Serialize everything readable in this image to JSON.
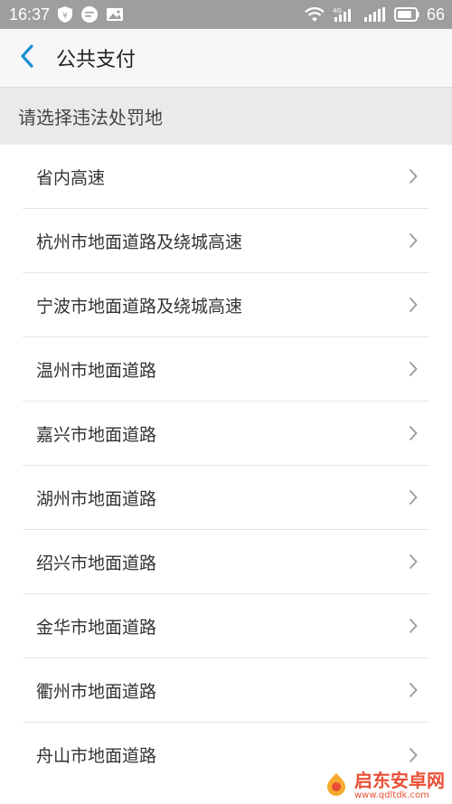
{
  "status_bar": {
    "time": "16:37",
    "battery_level": "66",
    "network_label": "4G"
  },
  "header": {
    "title": "公共支付"
  },
  "section": {
    "title": "请选择违法处罚地"
  },
  "regions": [
    {
      "label": "省内高速"
    },
    {
      "label": "杭州市地面道路及绕城高速"
    },
    {
      "label": "宁波市地面道路及绕城高速"
    },
    {
      "label": "温州市地面道路"
    },
    {
      "label": "嘉兴市地面道路"
    },
    {
      "label": "湖州市地面道路"
    },
    {
      "label": "绍兴市地面道路"
    },
    {
      "label": "金华市地面道路"
    },
    {
      "label": "衢州市地面道路"
    },
    {
      "label": "舟山市地面道路"
    }
  ],
  "watermark": {
    "brand": "启东安卓网",
    "url": "www.qdltdk.com"
  },
  "colors": {
    "status_bar_bg": "#9e9e9e",
    "accent_back": "#1a8fd6",
    "chevron": "#9a9a9a",
    "section_bg": "#eaeaec"
  }
}
